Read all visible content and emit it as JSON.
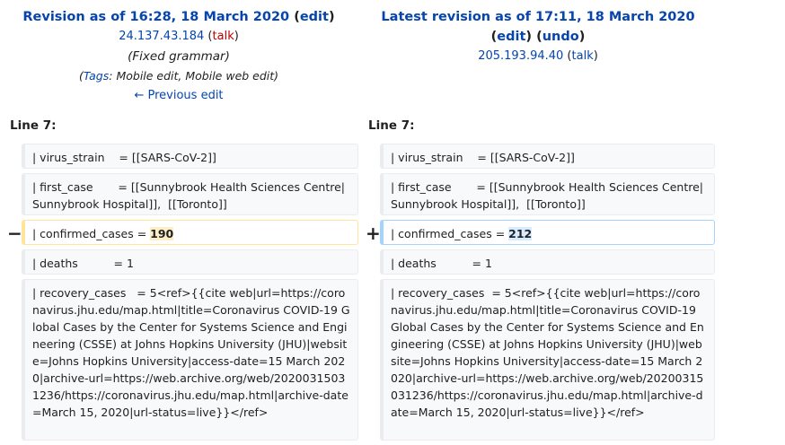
{
  "left_header": {
    "title": "Revision as of 16:28, 18 March 2020",
    "edit_label": "edit",
    "user": "24.137.43.184",
    "talk": "talk",
    "summary": "(Fixed grammar)",
    "tags_label": "Tags",
    "tags_text": ": Mobile edit, Mobile web edit)",
    "tags_open": "(",
    "prev_edit": "← Previous edit"
  },
  "right_header": {
    "title": "Latest revision as of 17:11, 18 March 2020",
    "edit_label": "edit",
    "undo_label": "undo",
    "user": "205.193.94.40",
    "talk": "talk"
  },
  "line_label": "Line 7:",
  "markers": {
    "minus": "−",
    "plus": "+"
  },
  "rows": {
    "virus_strain": "| virus_strain    = [[SARS-CoV-2]]",
    "first_case": "| first_case       = [[Sunnybrook Health Sciences Centre|Sunnybrook Hospital]],  [[Toronto]]",
    "confirmed_prefix": "| confirmed_cases = ",
    "confirmed_old": "190",
    "confirmed_new": "212",
    "deaths": "| deaths          = 1",
    "recovery_left": "| recovery_cases   = 5<ref>{{cite web|url=https://coronavirus.jhu.edu/map.html|title=Coronavirus COVID-19 Global Cases by the Center for Systems Science and Engineering (CSSE) at Johns Hopkins University (JHU)|website=Johns Hopkins University|access-date=15 March 2020|archive-url=https://web.archive.org/web/20200315031236/https://coronavirus.jhu.edu/map.html|archive-date=March 15, 2020|url-status=live}}</ref>",
    "recovery_right": "| recovery_cases  = 5<ref>{{cite web|url=https://coronavirus.jhu.edu/map.html|title=Coronavirus COVID-19 Global Cases by the Center for Systems Science and Engineering (CSSE) at Johns Hopkins University (JHU)|website=Johns Hopkins University|access-date=15 March 2020|archive-url=https://web.archive.org/web/20200315031236/https://coronavirus.jhu.edu/map.html|archive-date=March 15, 2020|url-status=live}}</ref>"
  },
  "colors": {
    "link": "#0645ad",
    "talk_red": "#ba0000",
    "del_border": "#ffe49c",
    "add_border": "#a3d3ff"
  }
}
